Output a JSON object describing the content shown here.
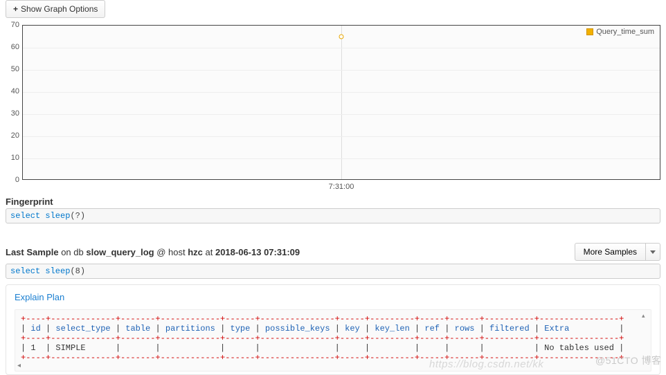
{
  "toolbar": {
    "show_graph_options": "Show Graph Options"
  },
  "chart_data": {
    "type": "scatter",
    "title": "",
    "xlabel": "",
    "ylabel": "",
    "ylim": [
      0,
      70
    ],
    "yticks": [
      0,
      10,
      20,
      30,
      40,
      50,
      60,
      70
    ],
    "xticks": [
      "7:31:00"
    ],
    "legend_position": "top-right",
    "series": [
      {
        "name": "Query_time_sum",
        "color": "#f2b100",
        "points": [
          {
            "x": "7:31:00",
            "y": 65
          }
        ]
      }
    ]
  },
  "fingerprint": {
    "label": "Fingerprint",
    "sql_kw": "select sleep",
    "sql_arg": "(?)"
  },
  "last_sample": {
    "prefix": "Last Sample",
    "on": " on db ",
    "db": "slow_query_log",
    "at_host": " @ host ",
    "host": "hzc",
    "at_time": " at ",
    "timestamp": "2018-06-13 07:31:09",
    "more_samples": "More Samples",
    "sql_kw": "select sleep",
    "sql_arg": "(8)"
  },
  "explain": {
    "title": "Explain Plan",
    "columns": [
      "id",
      "select_type",
      "table",
      "partitions",
      "type",
      "possible_keys",
      "key",
      "key_len",
      "ref",
      "rows",
      "filtered",
      "Extra"
    ],
    "rows": [
      {
        "id": "1",
        "select_type": "SIMPLE",
        "table": "",
        "partitions": "",
        "type": "",
        "possible_keys": "",
        "key": "",
        "key_len": "",
        "ref": "",
        "rows": "",
        "filtered": "",
        "Extra": "No tables used"
      }
    ]
  },
  "watermark": {
    "url": "https://blog.csdn.net/kk",
    "badge": "@51CTO 博客"
  }
}
